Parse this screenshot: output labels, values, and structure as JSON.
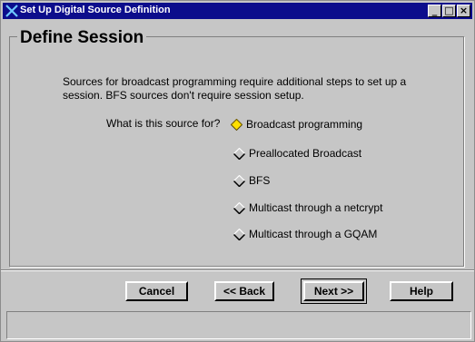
{
  "window": {
    "title": "Set Up Digital Source Definition",
    "minimize_label": "_",
    "maximize_label": "□",
    "close_label": "×"
  },
  "group": {
    "title": "Define Session"
  },
  "description": "Sources for broadcast programming require additional steps to set up a session.  BFS sources don't require session setup.",
  "question": "What is this source for?",
  "options": [
    {
      "label": "Broadcast programming",
      "selected": true
    },
    {
      "label": "Preallocated Broadcast",
      "selected": false
    },
    {
      "label": "BFS",
      "selected": false
    },
    {
      "label": "Multicast through a netcrypt",
      "selected": false
    },
    {
      "label": "Multicast through a GQAM",
      "selected": false
    }
  ],
  "buttons": {
    "cancel": "Cancel",
    "back": "<< Back",
    "next": "Next >>",
    "help": "Help"
  },
  "status": "",
  "colors": {
    "titlebar": "#0c0d8c",
    "face": "#c6c6c6",
    "selected_radio": "#ffe000"
  }
}
